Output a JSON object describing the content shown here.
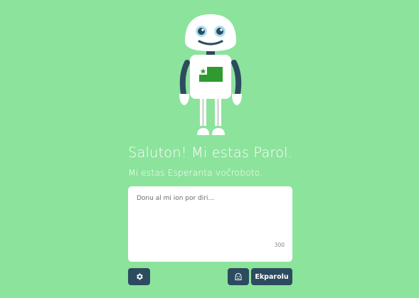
{
  "robot": {
    "name": "Parol"
  },
  "greeting": "Saluton! Mi estas Parol.",
  "subtitle": "Mi estas Esperanta voĉroboto.",
  "input": {
    "placeholder": "Donu al mi ion por diri...",
    "value": "",
    "char_count": "300"
  },
  "buttons": {
    "settings_icon": "gear-icon",
    "speak_icon": "robot-speak-icon",
    "submit_label": "Ekparolu"
  },
  "colors": {
    "background": "#8ce39c",
    "button": "#2d4b5e",
    "flag_green": "#2f9a2f"
  }
}
